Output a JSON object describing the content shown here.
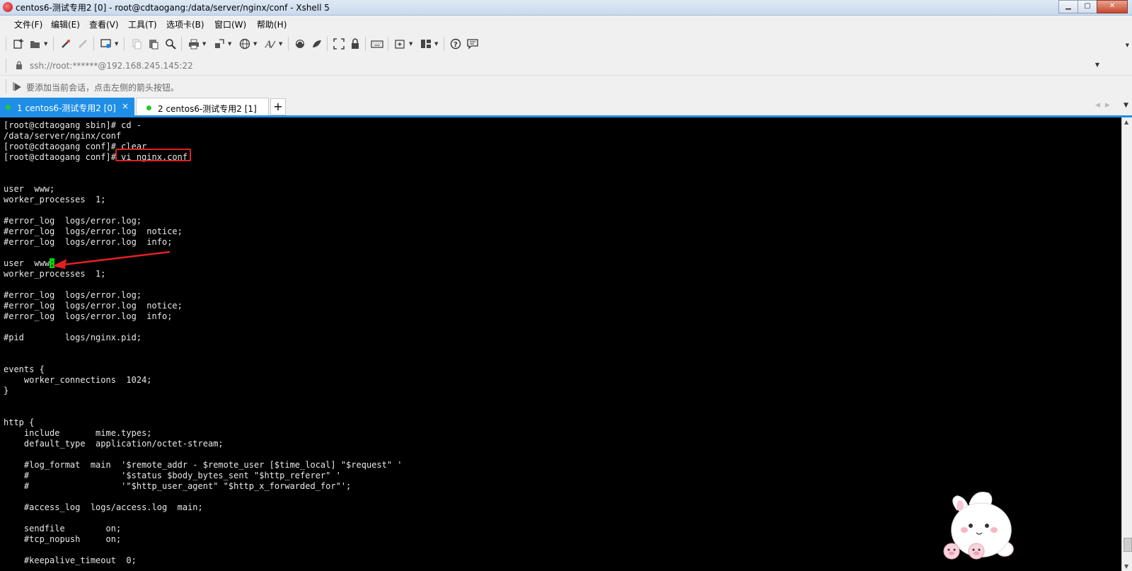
{
  "window": {
    "title": "centos6-测试专用2 [0] - root@cdtaogang:/data/server/nginx/conf - Xshell 5",
    "minimize": "▁",
    "maximize": "▢",
    "close": "✕"
  },
  "menu": [
    {
      "label": "文件(F)"
    },
    {
      "label": "编辑(E)"
    },
    {
      "label": "查看(V)"
    },
    {
      "label": "工具(T)"
    },
    {
      "label": "选项卡(B)"
    },
    {
      "label": "窗口(W)"
    },
    {
      "label": "帮助(H)"
    }
  ],
  "toolbar": {
    "icons": [
      "new-session-icon",
      "open-folder-icon",
      "connect-icon",
      "disconnect-icon",
      "properties-icon",
      "copy-icon",
      "paste-icon",
      "find-icon",
      "print-icon",
      "transfer-icon",
      "globe-icon",
      "font-icon",
      "xftp-icon",
      "xmanager-icon",
      "fullscreen-icon",
      "lock-icon",
      "keyboard-icon",
      "new-tab-icon",
      "layout-icon",
      "help-icon",
      "chat-icon"
    ]
  },
  "address": {
    "value": "ssh://root:******@192.168.245.145:22"
  },
  "hint": {
    "text": "要添加当前会话，点击左侧的箭头按钮。"
  },
  "tabs": [
    {
      "label": "1 centos6-测试专用2 [0]",
      "active": true,
      "close": "×"
    },
    {
      "label": "2 centos6-测试专用2 [1]",
      "active": false
    }
  ],
  "tab_add": "+",
  "terminal": {
    "lines_before_cursor": "[root@cdtaogang sbin]# cd -\n/data/server/nginx/conf\n[root@cdtaogang conf]# clear\n[root@cdtaogang conf]# vi nginx.conf\n\n\nuser  www;\nworker_processes  1;\n\n#error_log  logs/error.log;\n#error_log  logs/error.log  notice;\n#error_log  logs/error.log  info;\n\nuser  www",
    "cursor_char": ";",
    "lines_after_cursor": "\nworker_processes  1;\n\n#error_log  logs/error.log;\n#error_log  logs/error.log  notice;\n#error_log  logs/error.log  info;\n\n#pid        logs/nginx.pid;\n\n\nevents {\n    worker_connections  1024;\n}\n\n\nhttp {\n    include       mime.types;\n    default_type  application/octet-stream;\n\n    #log_format  main  '$remote_addr - $remote_user [$time_local] \"$request\" '\n    #                  '$status $body_bytes_sent \"$http_referer\" '\n    #                  '\"$http_user_agent\" \"$http_x_forwarded_for\"';\n\n    #access_log  logs/access.log  main;\n\n    sendfile        on;\n    #tcp_nopush     on;\n\n    #keepalive_timeout  0;"
  },
  "colors": {
    "tab_active": "#1e8ee6",
    "cursor": "#00d800",
    "annotation": "#e02020"
  }
}
